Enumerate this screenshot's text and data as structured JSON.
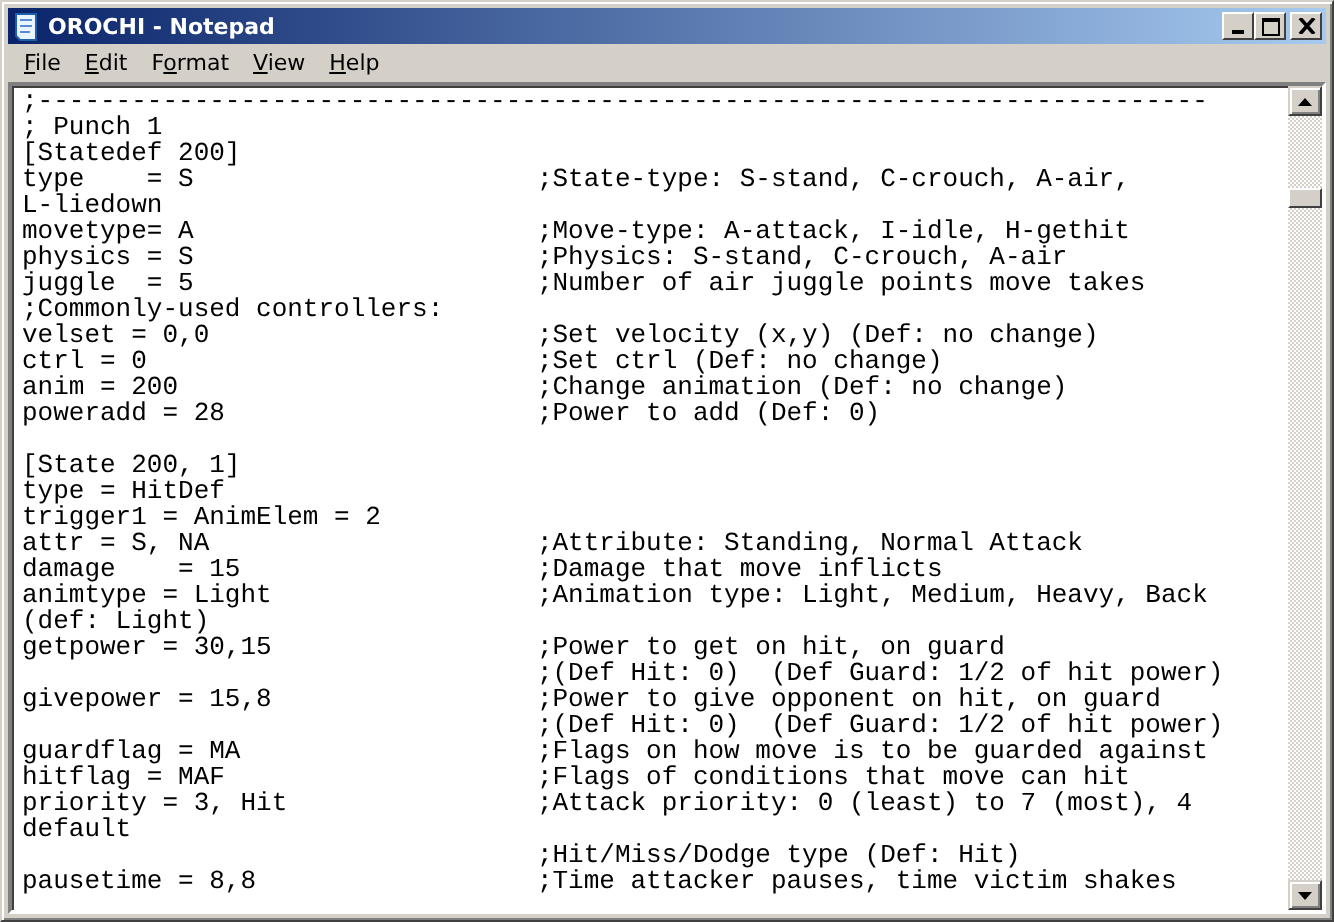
{
  "window": {
    "title": "OROCHI - Notepad"
  },
  "menu": [
    {
      "mnemonic": "F",
      "post": "ile"
    },
    {
      "mnemonic": "E",
      "post": "dit"
    },
    {
      "pre": "F",
      "mnemonic": "o",
      "post": "rmat"
    },
    {
      "mnemonic": "V",
      "post": "iew"
    },
    {
      "mnemonic": "H",
      "post": "elp"
    }
  ],
  "lines": [
    {
      "code": ";---------------------------------------------------------------------------"
    },
    {
      "code": "; Punch 1"
    },
    {
      "code": "[Statedef 200]"
    },
    {
      "code": "type    = S",
      "comment": ";State-type: S-stand, C-crouch, A-air,"
    },
    {
      "code": "L-liedown"
    },
    {
      "code": "movetype= A",
      "comment": ";Move-type: A-attack, I-idle, H-gethit"
    },
    {
      "code": "physics = S",
      "comment": ";Physics: S-stand, C-crouch, A-air"
    },
    {
      "code": "juggle  = 5",
      "comment": ";Number of air juggle points move takes"
    },
    {
      "code": ";Commonly-used controllers:"
    },
    {
      "code": "velset = 0,0",
      "comment": ";Set velocity (x,y) (Def: no change)"
    },
    {
      "code": "ctrl = 0",
      "comment": ";Set ctrl (Def: no change)"
    },
    {
      "code": "anim = 200",
      "comment": ";Change animation (Def: no change)"
    },
    {
      "code": "poweradd = 28",
      "comment": ";Power to add (Def: 0)"
    },
    {
      "kind": "blank"
    },
    {
      "code": "[State 200, 1]"
    },
    {
      "code": "type = HitDef"
    },
    {
      "code": "trigger1 = AnimElem = 2"
    },
    {
      "code": "attr = S, NA",
      "comment": ";Attribute: Standing, Normal Attack"
    },
    {
      "code": "damage    = 15",
      "comment": ";Damage that move inflicts"
    },
    {
      "code": "animtype = Light",
      "comment": ";Animation type: Light, Medium, Heavy, Back"
    },
    {
      "code": "(def: Light)"
    },
    {
      "code": "getpower = 30,15",
      "comment": ";Power to get on hit, on guard"
    },
    {
      "comment": ";(Def Hit: 0)  (Def Guard: 1/2 of hit power)"
    },
    {
      "code": "givepower = 15,8",
      "comment": ";Power to give opponent on hit, on guard"
    },
    {
      "comment": ";(Def Hit: 0)  (Def Guard: 1/2 of hit power)"
    },
    {
      "code": "guardflag = MA",
      "comment": ";Flags on how move is to be guarded against"
    },
    {
      "code": "hitflag = MAF",
      "comment": ";Flags of conditions that move can hit"
    },
    {
      "code": "priority = 3, Hit",
      "comment": ";Attack priority: 0 (least) to 7 (most), 4"
    },
    {
      "code": "default"
    },
    {
      "comment": ";Hit/Miss/Dodge type (Def: Hit)"
    },
    {
      "code": "pausetime = 8,8",
      "comment": ";Time attacker pauses, time victim shakes"
    }
  ]
}
